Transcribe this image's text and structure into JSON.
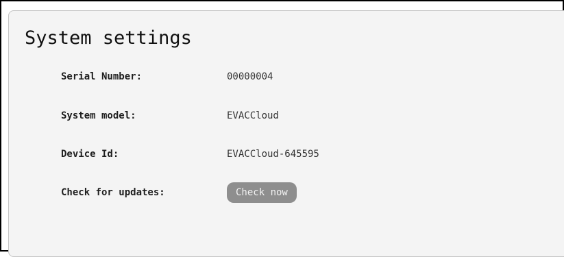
{
  "page": {
    "title": "System settings"
  },
  "settings": {
    "rows": [
      {
        "label": "Serial Number:",
        "value": "00000004"
      },
      {
        "label": "System model:",
        "value": "EVACCloud"
      },
      {
        "label": "Device Id:",
        "value": "EVACCloud-645595"
      },
      {
        "label": "Check for updates:"
      }
    ],
    "check_now_label": "Check now"
  },
  "colors": {
    "panel_background": "#f4f4f4",
    "button_background": "#8e8e8e",
    "button_text": "#f2f2f2"
  }
}
